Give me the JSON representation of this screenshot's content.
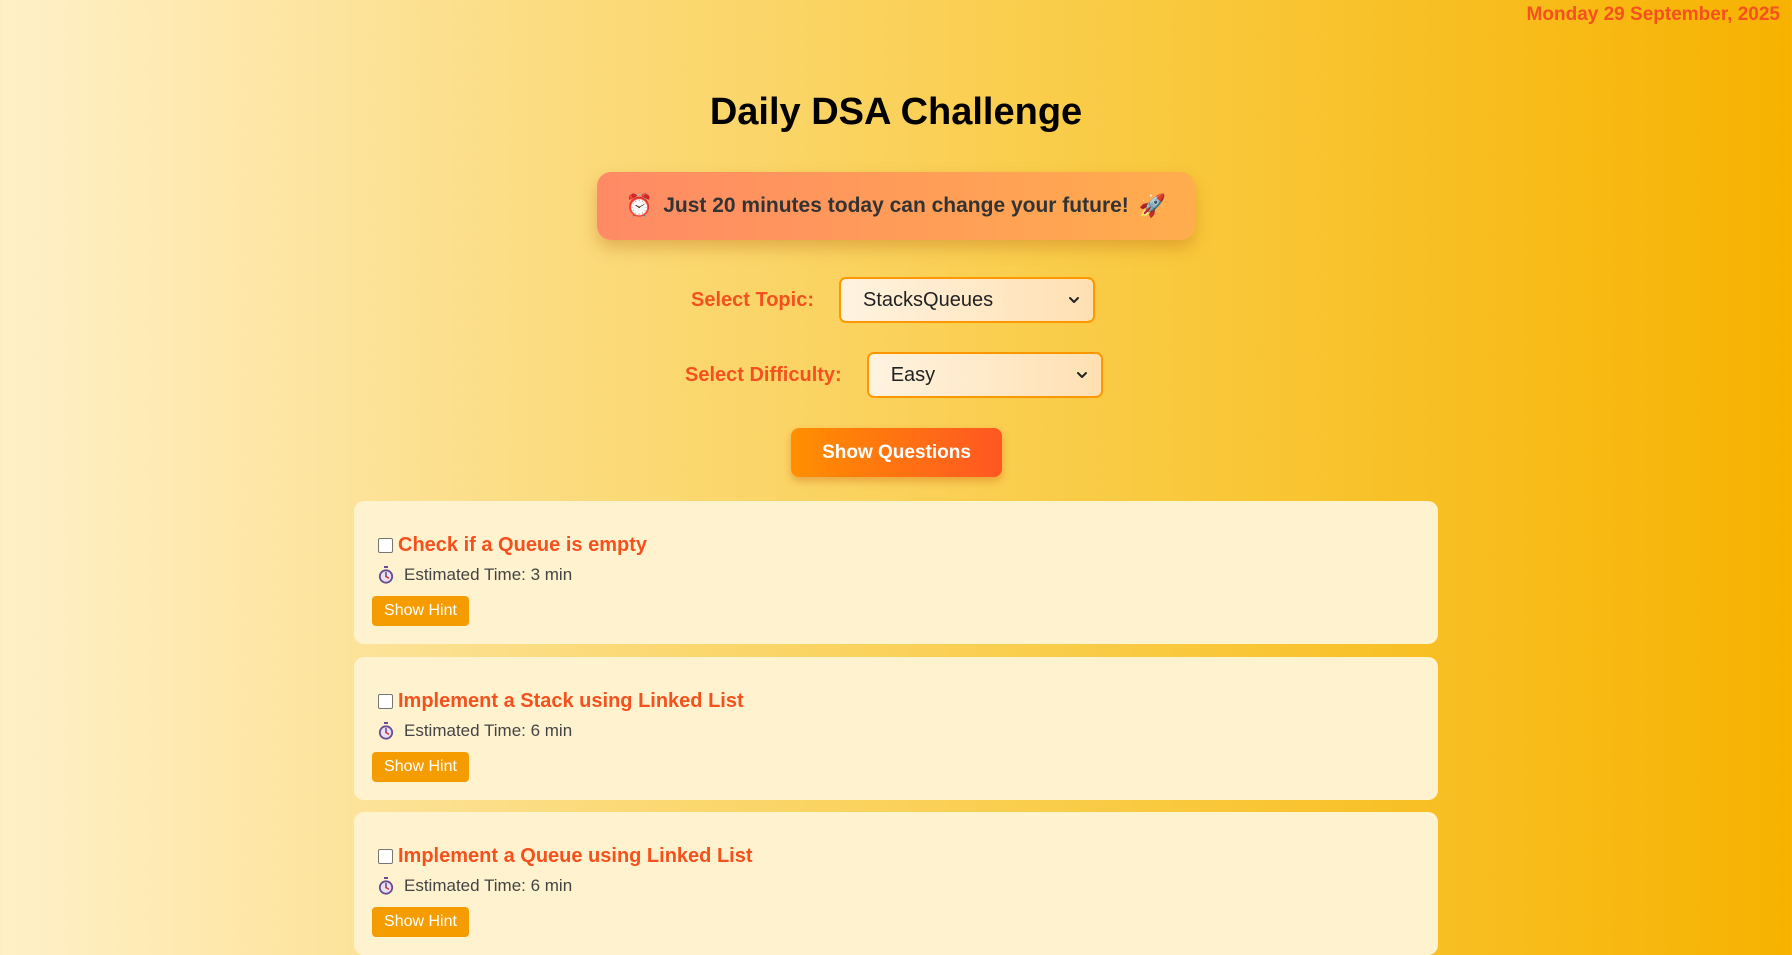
{
  "header": {
    "date": "Monday 29 September, 2025",
    "title": "Daily DSA Challenge"
  },
  "motivation": {
    "left_emoji": "⏰",
    "text": "Just 20 minutes today can change your future!",
    "right_emoji": "🚀"
  },
  "filters": {
    "topic_label": "Select Topic:",
    "topic_value": "StacksQueues",
    "difficulty_label": "Select Difficulty:",
    "difficulty_value": "Easy"
  },
  "show_questions_label": "Show Questions",
  "questions": [
    {
      "title": "Check if a Queue is empty",
      "time": "Estimated Time: 3 min",
      "hint_label": "Show Hint"
    },
    {
      "title": "Implement a Stack using Linked List",
      "time": "Estimated Time: 6 min",
      "hint_label": "Show Hint"
    },
    {
      "title": "Implement a Queue using Linked List",
      "time": "Estimated Time: 6 min",
      "hint_label": "Show Hint"
    }
  ],
  "colors": {
    "accent": "#f4511e",
    "button_orange": "#ff8f00",
    "hint_button": "#f59c00",
    "card_bg": "#fff3cf"
  },
  "icons": {
    "motivation_left": "alarm-clock-icon",
    "motivation_right": "rocket-icon",
    "time": "stopwatch-icon",
    "select": "chevron-down-icon"
  }
}
